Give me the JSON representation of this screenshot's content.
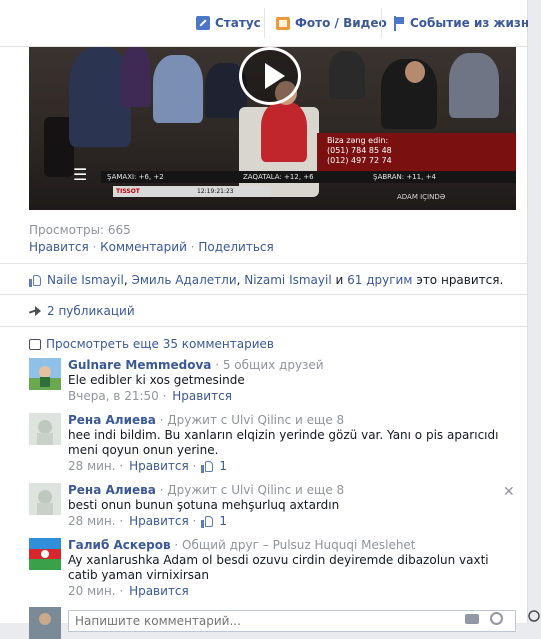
{
  "composer": {
    "status": "Статус",
    "photo_video": "Фото / Видео",
    "life_event": "Событие из жизни"
  },
  "video": {
    "phone_title": "Biza zəng edin:",
    "phone_1": "(051) 784 85 48",
    "phone_2": "(012) 497 72 74",
    "weather_1": "ŞAMAXI: +6, +2",
    "weather_2": "ZAQATALA: +12, +6",
    "weather_3": "ŞABRAN: +11, +4",
    "ticker_brand": "TISSOT",
    "ticker_time": "12:19:21:23",
    "channel": "ADAM IÇINDƏ"
  },
  "post": {
    "views": "Просмотры: 665",
    "like": "Нравится",
    "comment": "Комментарий",
    "share": "Поделиться",
    "sep": " · "
  },
  "likes": {
    "names": [
      "Naile Ismayil",
      "Эмиль Адалетли",
      "Nizami Ismayil"
    ],
    "and": "и",
    "others": "61 другим",
    "suffix": "это нравится."
  },
  "shares": "2 публикаций",
  "more_comments": "Просмотреть еще 35 комментариев",
  "comments": [
    {
      "name": "Gulnare Memmedova",
      "sub": " · 5 общих друзей",
      "text": "Ele edibler ki xos getmesinde",
      "time": "Вчера, в 21:50",
      "like": "Нравится",
      "likes": ""
    },
    {
      "name": "Рена Алиева",
      "sub": " · Дружит с Ulvi Qilinc и еще 8",
      "text": "hee indi bildim. Bu xanların elqizin yerinde gözü var. Yanı o pis aparıcıdı meni qoyun onun yerine.",
      "time": "28 мин.",
      "like": "Нравится",
      "likes": "1"
    },
    {
      "name": "Рена Алиева",
      "sub": " · Дружит с Ulvi Qilinc и еще 8",
      "text": "besti onun bunun şotuna mehşurluq axtardın",
      "time": "28 мин.",
      "like": "Нравится",
      "likes": "1"
    },
    {
      "name": "Галиб Аскеров",
      "sub": " · Общий друг – Pulsuz Huquqi Meslehet",
      "text": "Ay xanlarushka Adam ol besdi ozuvu cirdin deyiremde dibazolun vaxti catib yaman virnixirsan",
      "time": "20 мин.",
      "like": "Нравится",
      "likes": ""
    }
  ],
  "write_comment_placeholder": "Напишите комментарий...",
  "colors": {
    "link": "#3b5998",
    "muted": "#90949c",
    "border": "#e5e5e5"
  }
}
